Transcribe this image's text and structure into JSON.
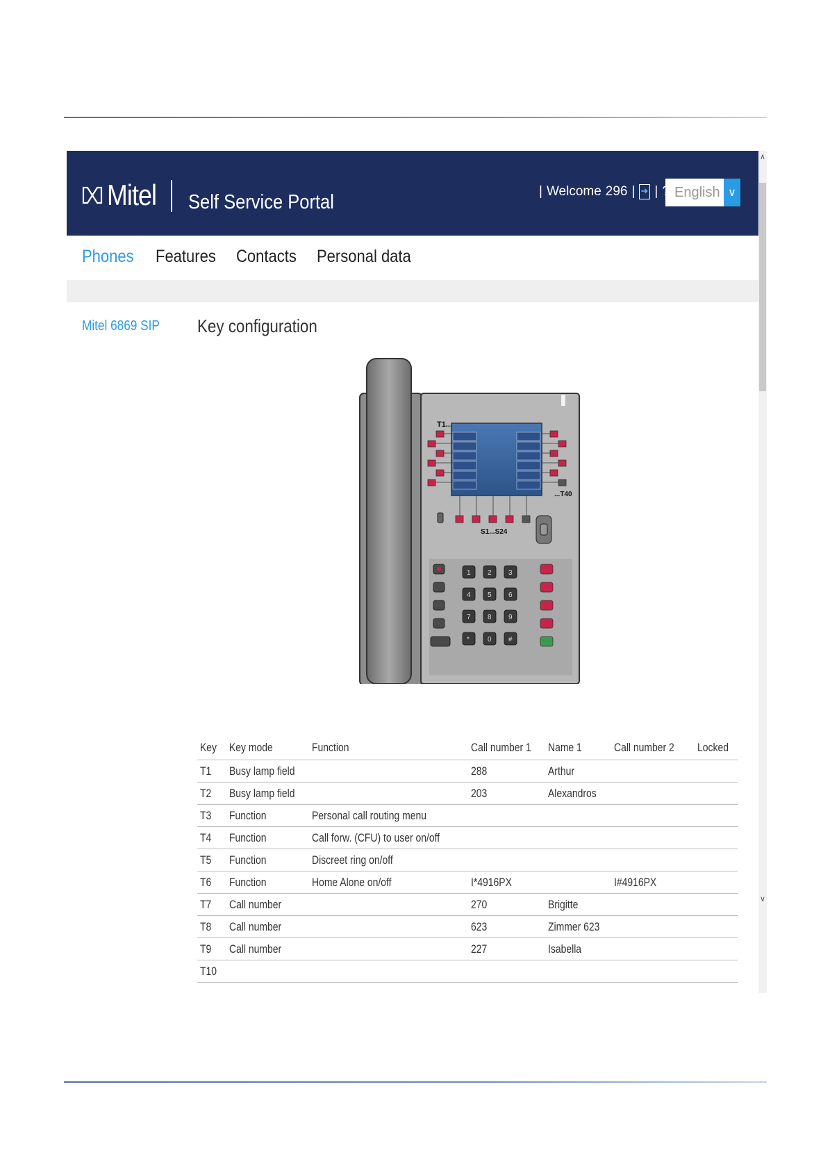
{
  "header": {
    "logo_text": "Mitel",
    "portal_title": "Self Service Portal",
    "welcome_label": "Welcome",
    "user_number": "296",
    "help_label": "?",
    "language": "English",
    "colors": {
      "header_bg": "#1c2d5e",
      "accent": "#2b9be3"
    }
  },
  "nav": {
    "items": [
      {
        "label": "Phones",
        "active": true
      },
      {
        "label": "Features",
        "active": false
      },
      {
        "label": "Contacts",
        "active": false
      },
      {
        "label": "Personal data",
        "active": false
      }
    ]
  },
  "sidebar": {
    "phone_model": "Mitel 6869 SIP"
  },
  "main": {
    "title": "Key configuration",
    "phone_image": {
      "label_top_keys": "T1...",
      "label_bottom_right": "...T40",
      "label_softkeys": "S1...S24"
    },
    "table": {
      "headers": [
        "Key",
        "Key mode",
        "Function",
        "Call number 1",
        "Name 1",
        "Call number 2",
        "Locked"
      ],
      "rows": [
        [
          "T1",
          "Busy lamp field",
          "",
          "288",
          "Arthur",
          "",
          ""
        ],
        [
          "T2",
          "Busy lamp field",
          "",
          "203",
          "Alexandros",
          "",
          ""
        ],
        [
          "T3",
          "Function",
          "Personal call routing menu",
          "",
          "",
          "",
          ""
        ],
        [
          "T4",
          "Function",
          "Call forw. (CFU) to user on/off",
          "",
          "",
          "",
          ""
        ],
        [
          "T5",
          "Function",
          "Discreet ring on/off",
          "",
          "",
          "",
          ""
        ],
        [
          "T6",
          "Function",
          "Home Alone on/off",
          "I*4916PX",
          "",
          "I#4916PX",
          ""
        ],
        [
          "T7",
          "Call number",
          "",
          "270",
          "Brigitte",
          "",
          ""
        ],
        [
          "T8",
          "Call number",
          "",
          "623",
          "Zimmer 623",
          "",
          ""
        ],
        [
          "T9",
          "Call number",
          "",
          "227",
          "Isabella",
          "",
          ""
        ],
        [
          "T10",
          "",
          "",
          "",
          "",
          "",
          ""
        ]
      ]
    }
  }
}
